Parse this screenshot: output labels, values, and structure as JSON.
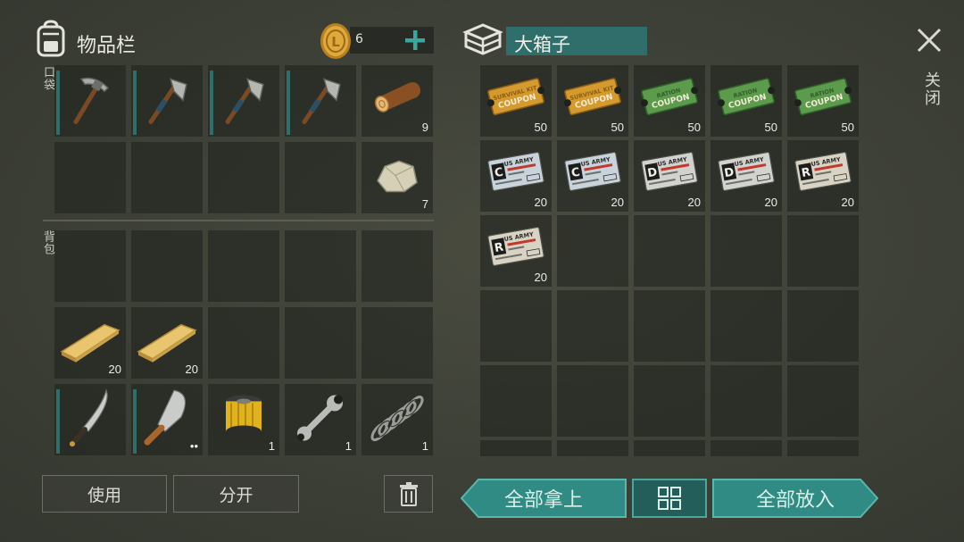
{
  "inventory": {
    "title": "物品栏",
    "coins": "6",
    "pocket_label": "口袋",
    "backpack_label": "背包",
    "pocket_slots": [
      {
        "icon": "pickaxe-icon",
        "qty": "",
        "bar": true
      },
      {
        "icon": "hatchet-icon",
        "qty": "",
        "bar": true
      },
      {
        "icon": "hatchet-icon",
        "qty": "",
        "bar": true
      },
      {
        "icon": "hatchet-icon",
        "qty": "",
        "bar": true
      },
      {
        "icon": "log-icon",
        "qty": "9",
        "bar": false
      },
      {
        "icon": "",
        "qty": "",
        "bar": false
      },
      {
        "icon": "",
        "qty": "",
        "bar": false
      },
      {
        "icon": "",
        "qty": "",
        "bar": false
      },
      {
        "icon": "",
        "qty": "",
        "bar": false
      },
      {
        "icon": "stone-icon",
        "qty": "7",
        "bar": false
      }
    ],
    "backpack_slots": [
      {
        "icon": "",
        "qty": ""
      },
      {
        "icon": "",
        "qty": ""
      },
      {
        "icon": "",
        "qty": ""
      },
      {
        "icon": "",
        "qty": ""
      },
      {
        "icon": "",
        "qty": ""
      },
      {
        "icon": "plank-icon",
        "qty": "20"
      },
      {
        "icon": "plank-icon",
        "qty": "20"
      },
      {
        "icon": "",
        "qty": ""
      },
      {
        "icon": "",
        "qty": ""
      },
      {
        "icon": "",
        "qty": ""
      },
      {
        "icon": "machete-icon",
        "qty": "",
        "bar": true
      },
      {
        "icon": "cleaver-icon",
        "qty": "••",
        "bar": true
      },
      {
        "icon": "oil-filter-icon",
        "qty": "1"
      },
      {
        "icon": "wrench-icon",
        "qty": "1"
      },
      {
        "icon": "spring-icon",
        "qty": "1"
      }
    ],
    "use_button": "使用",
    "split_button": "分开"
  },
  "chest": {
    "title": "大箱子",
    "close_label": "关闭",
    "take_all": "全部拿上",
    "put_all": "全部放入",
    "coupons": [
      {
        "kind": "survival",
        "line1": "SURVIVAL KIT",
        "line2": "COUPON",
        "qty": "50"
      },
      {
        "kind": "survival",
        "line1": "SURVIVAL KIT",
        "line2": "COUPON",
        "qty": "50"
      },
      {
        "kind": "ration",
        "line1": "RATION",
        "line2": "COUPON",
        "qty": "50"
      },
      {
        "kind": "ration",
        "line1": "RATION",
        "line2": "COUPON",
        "qty": "50"
      },
      {
        "kind": "ration",
        "line1": "RATION",
        "line2": "COUPON",
        "qty": "50"
      },
      {
        "kind": "army",
        "grade": "C",
        "header": "US ARMY",
        "qty": "20",
        "tint": "#c9d3dc"
      },
      {
        "kind": "army",
        "grade": "C",
        "header": "US ARMY",
        "qty": "20",
        "tint": "#c9d3dc"
      },
      {
        "kind": "army",
        "grade": "D",
        "header": "US ARMY",
        "qty": "20",
        "tint": "#d2d2cf"
      },
      {
        "kind": "army",
        "grade": "D",
        "header": "US ARMY",
        "qty": "20",
        "tint": "#d2d2cf"
      },
      {
        "kind": "army",
        "grade": "R",
        "header": "US ARMY",
        "qty": "20",
        "tint": "#d9d3c4"
      },
      {
        "kind": "army",
        "grade": "R",
        "header": "US ARMY",
        "qty": "20",
        "tint": "#d9d3c4"
      }
    ]
  },
  "colors": {
    "accent": "#2f8b83",
    "accent_light": "#3aa79c",
    "tag_bg": "#2f6e6a",
    "coin": "#d9a23a"
  }
}
